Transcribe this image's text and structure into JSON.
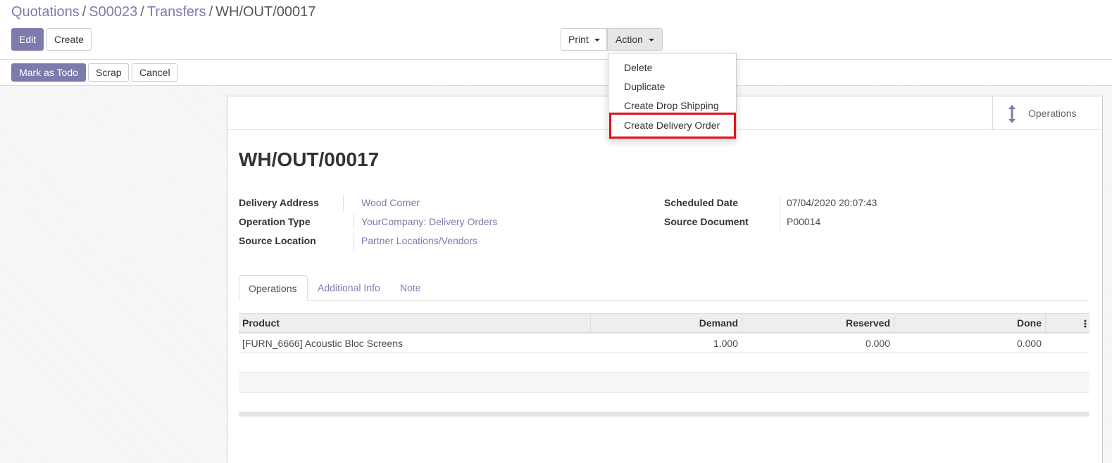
{
  "breadcrumb": {
    "items": [
      "Quotations",
      "S00023",
      "Transfers"
    ],
    "current": "WH/OUT/00017",
    "separator": "/"
  },
  "toolbar": {
    "edit_label": "Edit",
    "create_label": "Create",
    "print_label": "Print",
    "action_label": "Action"
  },
  "action_menu": {
    "items": [
      "Delete",
      "Duplicate",
      "Create Drop Shipping",
      "Create Delivery Order"
    ],
    "highlighted_item": "Create Delivery Order",
    "highlight_color": "#e3101e"
  },
  "statusbar": {
    "mark_todo_label": "Mark as Todo",
    "scrap_label": "Scrap",
    "cancel_label": "Cancel"
  },
  "smart_button": {
    "label": "Operations",
    "icon": "arrows-vertical-icon"
  },
  "record": {
    "title": "WH/OUT/00017",
    "fields_left": [
      {
        "label": "Delivery Address",
        "value": "Wood Corner"
      },
      {
        "label": "Operation Type",
        "value": "YourCompany: Delivery Orders"
      },
      {
        "label": "Source Location",
        "value": "Partner Locations/Vendors"
      }
    ],
    "fields_right": [
      {
        "label": "Scheduled Date",
        "value": "07/04/2020 20:07:43"
      },
      {
        "label": "Source Document",
        "value": "P00014"
      }
    ]
  },
  "tabs": [
    {
      "label": "Operations",
      "active": true
    },
    {
      "label": "Additional Info",
      "active": false
    },
    {
      "label": "Note",
      "active": false
    }
  ],
  "operations_table": {
    "columns": [
      "Product",
      "Demand",
      "Reserved",
      "Done"
    ],
    "rows": [
      {
        "product": "[FURN_6666] Acoustic Bloc Screens",
        "demand": "1.000",
        "reserved": "0.000",
        "done": "0.000"
      }
    ]
  },
  "colors": {
    "brand": "#7c7bad",
    "highlight": "#e3101e"
  }
}
